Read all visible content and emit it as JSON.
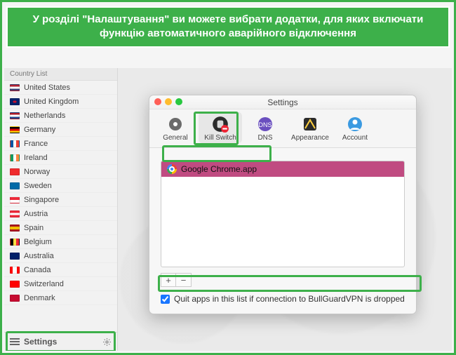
{
  "banner_text": "У розділі \"Налаштування\" ви можете вибрати додатки, для яких включати функцію автоматичного аварійного відключення",
  "sidebar": {
    "header": "Country List",
    "items": [
      {
        "label": "United States",
        "flag": "f-us"
      },
      {
        "label": "United Kingdom",
        "flag": "f-uk"
      },
      {
        "label": "Netherlands",
        "flag": "f-nl"
      },
      {
        "label": "Germany",
        "flag": "f-de"
      },
      {
        "label": "France",
        "flag": "f-fr"
      },
      {
        "label": "Ireland",
        "flag": "f-ie"
      },
      {
        "label": "Norway",
        "flag": "f-no"
      },
      {
        "label": "Sweden",
        "flag": "f-se"
      },
      {
        "label": "Singapore",
        "flag": "f-sg"
      },
      {
        "label": "Austria",
        "flag": "f-at"
      },
      {
        "label": "Spain",
        "flag": "f-es"
      },
      {
        "label": "Belgium",
        "flag": "f-be"
      },
      {
        "label": "Australia",
        "flag": "f-au"
      },
      {
        "label": "Canada",
        "flag": "f-ca"
      },
      {
        "label": "Switzerland",
        "flag": "f-ch"
      },
      {
        "label": "Denmark",
        "flag": "f-dk"
      }
    ],
    "settings_label": "Settings"
  },
  "settings_window": {
    "title": "Settings",
    "tabs": [
      {
        "label": "General",
        "icon": "gear-icon"
      },
      {
        "label": "Kill Switch",
        "icon": "killswitch-icon"
      },
      {
        "label": "DNS",
        "icon": "dns-icon"
      },
      {
        "label": "Appearance",
        "icon": "appearance-icon"
      },
      {
        "label": "Account",
        "icon": "account-icon"
      }
    ],
    "app_list": [
      {
        "name": "Google Chrome.app",
        "icon": "chrome-icon"
      }
    ],
    "add_label": "+",
    "remove_label": "−",
    "quit_checkbox_label": "Quit apps in this list if connection to BullGuardVPN is dropped",
    "quit_checked": true
  }
}
